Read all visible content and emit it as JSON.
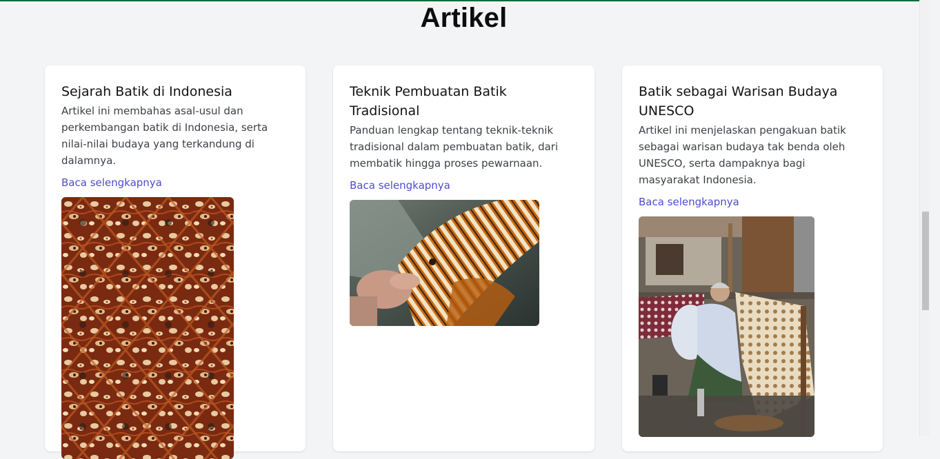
{
  "page": {
    "heading": "Artikel"
  },
  "articles": [
    {
      "title": "Sejarah Batik di Indonesia",
      "description": "Artikel ini membahas asal-usul dan perkembangan batik di Indonesia, serta nilai-nilai budaya yang terkandung di dalamnya.",
      "link_label": "Baca selengkapnya",
      "image": "batik-pattern-photo"
    },
    {
      "title": "Teknik Pembuatan Batik Tradisional",
      "description": "Panduan lengkap tentang teknik-teknik tradisional dalam pembuatan batik, dari membatik hingga proses pewarnaan.",
      "link_label": "Baca selengkapnya",
      "image": "hands-making-batik-photo"
    },
    {
      "title": "Batik sebagai Warisan Budaya UNESCO",
      "description": "Artikel ini menjelaskan pengakuan batik sebagai warisan budaya tak benda oleh UNESCO, serta dampaknya bagi masyarakat Indonesia.",
      "link_label": "Baca selengkapnya",
      "image": "elderly-woman-batik-workshop-photo"
    }
  ],
  "colors": {
    "background": "#f3f4f6",
    "card": "#ffffff",
    "link": "#4c4ccf",
    "accent_line": "#0b6b3a"
  }
}
